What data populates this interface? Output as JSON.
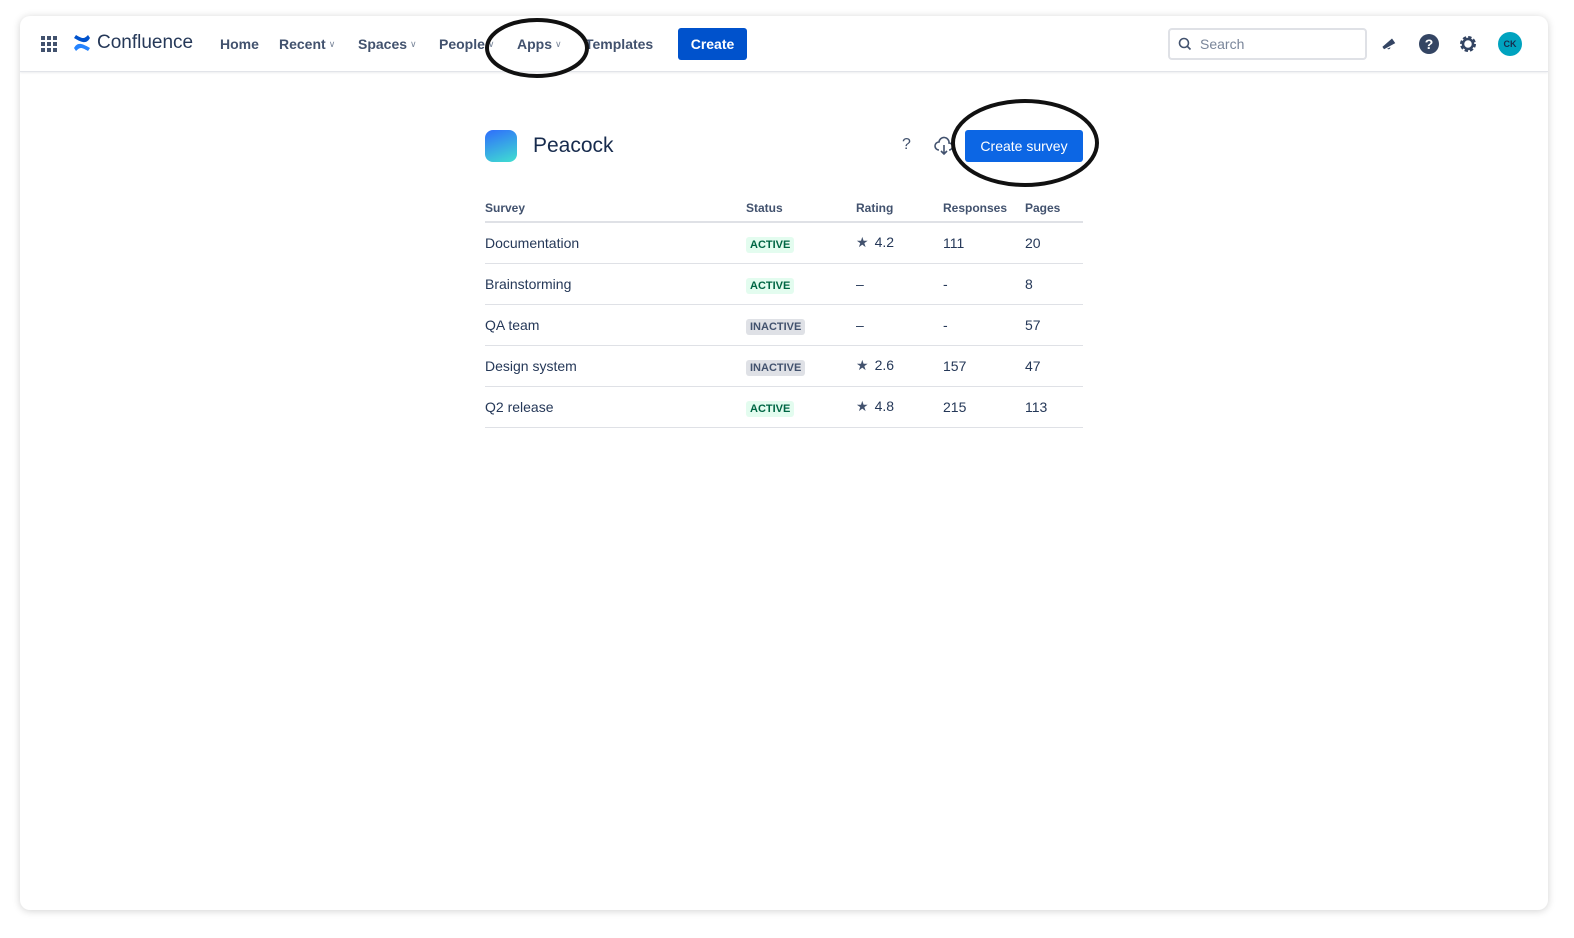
{
  "topbar": {
    "product": "Confluence",
    "nav": [
      {
        "label": "Home",
        "dropdown": false
      },
      {
        "label": "Recent",
        "dropdown": true
      },
      {
        "label": "Spaces",
        "dropdown": true
      },
      {
        "label": "People",
        "dropdown": true
      },
      {
        "label": "Apps",
        "dropdown": true
      },
      {
        "label": "Templates",
        "dropdown": false
      }
    ],
    "create_label": "Create",
    "search_placeholder": "Search",
    "avatar_initials": "CK"
  },
  "app": {
    "title": "Peacock",
    "help_label": "?",
    "create_survey_label": "Create survey"
  },
  "table": {
    "headers": [
      "Survey",
      "Status",
      "Rating",
      "Responses",
      "Pages"
    ],
    "rows": [
      {
        "survey": "Documentation",
        "status": "ACTIVE",
        "rating": "4.2",
        "responses": "111",
        "pages": "20"
      },
      {
        "survey": "Brainstorming",
        "status": "ACTIVE",
        "rating": "–",
        "responses": "-",
        "pages": "8"
      },
      {
        "survey": "QA team",
        "status": "INACTIVE",
        "rating": "–",
        "responses": "-",
        "pages": "57"
      },
      {
        "survey": "Design system",
        "status": "INACTIVE",
        "rating": "2.6",
        "responses": "157",
        "pages": "47"
      },
      {
        "survey": "Q2 release",
        "status": "ACTIVE",
        "rating": "4.8",
        "responses": "215",
        "pages": "113"
      }
    ]
  },
  "colors": {
    "primary": "#0052cc",
    "survey_button": "#0c66e4",
    "active_bg": "#e3fcef",
    "active_text": "#006644",
    "avatar": "#00a3bf"
  }
}
